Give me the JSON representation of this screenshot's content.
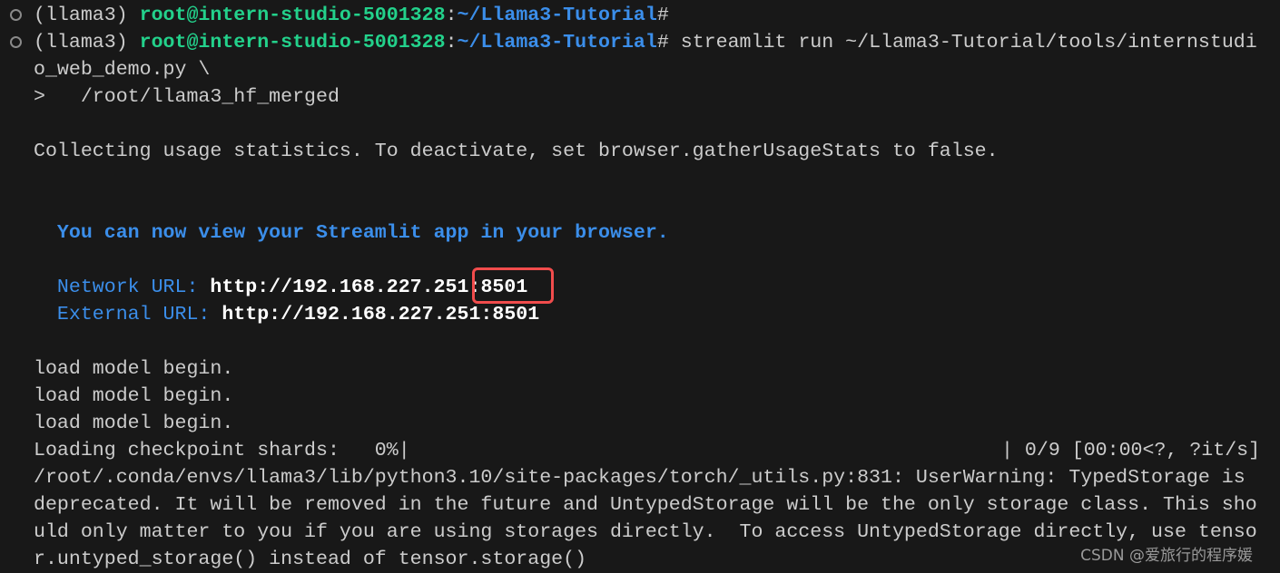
{
  "terminal": {
    "prompt1": {
      "env": "(llama3) ",
      "user": "root@intern-studio-5001328",
      "colon": ":",
      "path": "~/Llama3-Tutorial",
      "hash": "#"
    },
    "prompt2": {
      "env": "(llama3) ",
      "user": "root@intern-studio-5001328",
      "colon": ":",
      "path": "~/Llama3-Tutorial",
      "hash": "#",
      "command": " streamlit run ~/Llama3-Tutorial/tools/internstudi"
    },
    "cmd_cont1": "o_web_demo.py \\",
    "cmd_cont2": ">   /root/llama3_hf_merged",
    "collecting": "Collecting usage statistics. To deactivate, set browser.gatherUsageStats to false.",
    "view_msg": "  You can now view your Streamlit app in your browser.",
    "network_label": "  Network URL: ",
    "network_url": "http://192.168.227.251",
    "network_port": ":8501",
    "external_label": "  External URL: ",
    "external_url": "http://192.168.227.251:8501",
    "load1": "load model begin.",
    "load2": "load model begin.",
    "load3": "load model begin.",
    "progress_left": "Loading checkpoint shards:   0%|",
    "progress_right": "| 0/9 [00:00<?, ?it/s]",
    "progress_percent": 0,
    "warn1": "/root/.conda/envs/llama3/lib/python3.10/site-packages/torch/_utils.py:831: UserWarning: TypedStorage is",
    "warn2": "deprecated. It will be removed in the future and UntypedStorage will be the only storage class. This sho",
    "warn3": "uld only matter to you if you are using storages directly.  To access UntypedStorage directly, use tenso",
    "warn4": "r.untyped_storage() instead of tensor.storage()"
  },
  "watermark": "CSDN @爱旅行的程序媛",
  "colors": {
    "background": "#181818",
    "text": "#cccccc",
    "green": "#23d18b",
    "blue": "#3b8eea",
    "highlight_box": "#f14c4c"
  }
}
